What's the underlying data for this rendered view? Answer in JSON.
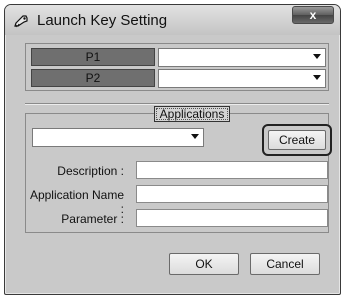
{
  "window": {
    "title": "Launch Key Setting",
    "icon": "key-icon",
    "close_glyph": "x"
  },
  "keys": [
    {
      "label": "P1",
      "selected": ""
    },
    {
      "label": "P2",
      "selected": ""
    }
  ],
  "applications": {
    "group_label": "Applications",
    "selected": "",
    "create_label": "Create",
    "description_label": "Description :",
    "description_value": "",
    "app_name_label": "Application Name :",
    "app_name_value": "",
    "parameter_label": "Parameter :",
    "parameter_value": ""
  },
  "footer": {
    "ok_label": "OK",
    "cancel_label": "Cancel"
  },
  "colors": {
    "dialog_bg": "#c9c9c9",
    "key_label_bg": "#6f6f6f"
  }
}
